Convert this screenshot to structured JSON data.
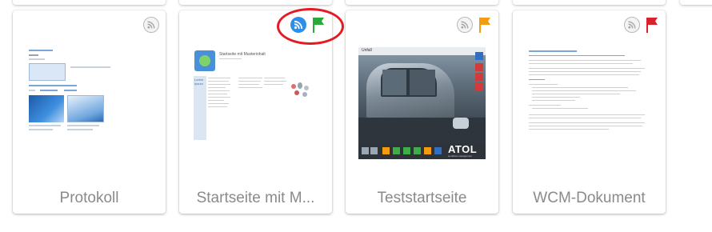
{
  "cards": [
    {
      "label": "Protokoll",
      "rss": "grey-rss-icon",
      "flag_color": null
    },
    {
      "label": "Startseite mit M...",
      "rss": "blue-rss-icon",
      "flag_color": "#2ba83a",
      "thumb": {
        "title": "Startseite mit Musterinhalt",
        "sidebar_heading": "Lorem Ipsum"
      }
    },
    {
      "label": "Teststartseite",
      "rss": "grey-rss-icon",
      "flag_color": "#f39c12",
      "thumb": {
        "logo": "ATOL",
        "logo_sub": "workflow management",
        "mini_title": "Unfall"
      }
    },
    {
      "label": "WCM-Dokument",
      "rss": "grey-rss-icon",
      "flag_color": "#d9212c"
    }
  ],
  "highlight_color": "#e41b23"
}
